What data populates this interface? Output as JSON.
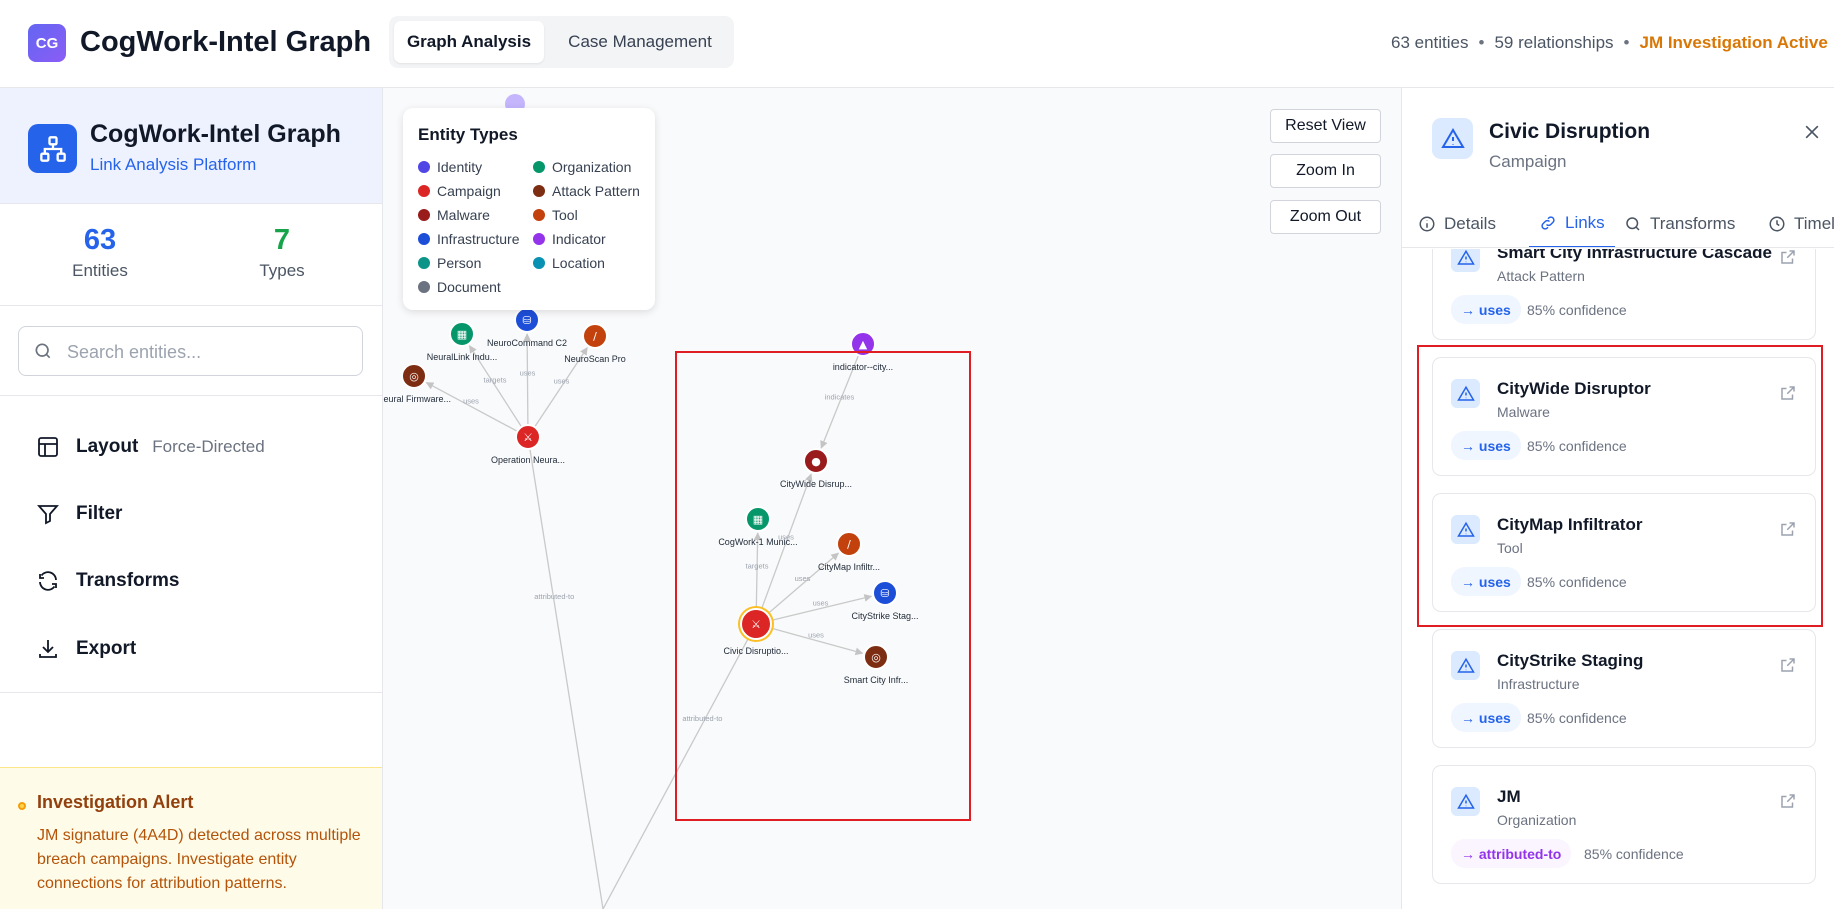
{
  "header": {
    "logo_text": "CG",
    "app_title": "CogWork-Intel Graph",
    "tabs": [
      {
        "label": "Graph Analysis",
        "active": true
      },
      {
        "label": "Case Management",
        "active": false
      }
    ],
    "stats": {
      "entities": "63 entities",
      "relationships": "59 relationships",
      "investigation": "JM Investigation Active"
    }
  },
  "sidebar": {
    "title": "CogWork-Intel Graph",
    "subtitle": "Link Analysis Platform",
    "stat_entities": {
      "value": "63",
      "label": "Entities"
    },
    "stat_types": {
      "value": "7",
      "label": "Types"
    },
    "search": {
      "placeholder": "Search entities..."
    },
    "menu": [
      {
        "label": "Layout",
        "value": "Force-Directed",
        "icon": "layout-icon"
      },
      {
        "label": "Filter",
        "icon": "filter-icon"
      },
      {
        "label": "Transforms",
        "icon": "transforms-icon"
      },
      {
        "label": "Export",
        "icon": "export-icon"
      }
    ],
    "alert": {
      "title": "Investigation Alert",
      "text": "JM signature (4A4D) detected across multiple breach campaigns. Investigate entity connections for attribution patterns."
    }
  },
  "canvas": {
    "legend": {
      "title": "Entity Types",
      "items": [
        {
          "label": "Identity",
          "color": "#4f46e5"
        },
        {
          "label": "Organization",
          "color": "#059669"
        },
        {
          "label": "Campaign",
          "color": "#dc2626"
        },
        {
          "label": "Attack Pattern",
          "color": "#7c2d12"
        },
        {
          "label": "Malware",
          "color": "#991b1b"
        },
        {
          "label": "Tool",
          "color": "#c2410c"
        },
        {
          "label": "Infrastructure",
          "color": "#1d4ed8"
        },
        {
          "label": "Indicator",
          "color": "#9333ea"
        },
        {
          "label": "Person",
          "color": "#0d9488"
        },
        {
          "label": "Location",
          "color": "#0891b2"
        },
        {
          "label": "Document",
          "color": "#6b7280"
        }
      ]
    },
    "controls": {
      "reset": "Reset View",
      "zoom_in": "Zoom In",
      "zoom_out": "Zoom Out"
    },
    "nodes": [
      {
        "id": "neurolink",
        "label": "NeuralLink Indu...",
        "type": "Organization",
        "color": "#059669",
        "glyph": "▦"
      },
      {
        "id": "neurocmd",
        "label": "NeuroCommand C2",
        "type": "Infrastructure",
        "color": "#1d4ed8",
        "glyph": "⛁"
      },
      {
        "id": "neuroscan",
        "label": "NeuroScan Pro",
        "type": "Tool",
        "color": "#c2410c",
        "glyph": "/"
      },
      {
        "id": "neuralfw",
        "label": "Neural Firmware...",
        "type": "Attack Pattern",
        "color": "#7c2d12",
        "glyph": "◎"
      },
      {
        "id": "opneura",
        "label": "Operation Neura...",
        "type": "Campaign",
        "color": "#dc2626",
        "glyph": "⚔"
      },
      {
        "id": "indicator",
        "label": "indicator--city...",
        "type": "Indicator",
        "color": "#9333ea",
        "glyph": "▲"
      },
      {
        "id": "citywide",
        "label": "CityWide Disrup...",
        "type": "Malware",
        "color": "#991b1b",
        "glyph": "●"
      },
      {
        "id": "cogwork",
        "label": "CogWork-1 Munic...",
        "type": "Organization",
        "color": "#059669",
        "glyph": "▦"
      },
      {
        "id": "citymap",
        "label": "CityMap Infiltr...",
        "type": "Tool",
        "color": "#c2410c",
        "glyph": "/"
      },
      {
        "id": "citystrike",
        "label": "CityStrike Stag...",
        "type": "Infrastructure",
        "color": "#1d4ed8",
        "glyph": "⛁"
      },
      {
        "id": "civic",
        "label": "Civic Disruptio...",
        "type": "Campaign",
        "color": "#dc2626",
        "glyph": "⚔",
        "selected": true
      },
      {
        "id": "smartcity",
        "label": "Smart City Infr...",
        "type": "Attack Pattern",
        "color": "#7c2d12",
        "glyph": "◎"
      }
    ],
    "edges": [
      {
        "label": "targets",
        "from": "opneura",
        "to": "neurolink"
      },
      {
        "label": "uses",
        "from": "opneura",
        "to": "neurocmd"
      },
      {
        "label": "uses",
        "from": "opneura",
        "to": "neuroscan"
      },
      {
        "label": "uses",
        "from": "opneura",
        "to": "neuralfw"
      },
      {
        "label": "attributed-to",
        "from": "opneura",
        "to": "jm-below"
      },
      {
        "label": "indicates",
        "from": "indicator",
        "to": "citywide"
      },
      {
        "label": "targets",
        "from": "civic",
        "to": "cogwork"
      },
      {
        "label": "uses",
        "from": "civic",
        "to": "citywide"
      },
      {
        "label": "uses",
        "from": "civic",
        "to": "citymap"
      },
      {
        "label": "uses",
        "from": "civic",
        "to": "citystrike"
      },
      {
        "label": "uses",
        "from": "civic",
        "to": "smartcity"
      },
      {
        "label": "attributed-to",
        "from": "civic",
        "to": "jm-below"
      }
    ]
  },
  "details": {
    "title": "Civic Disruption",
    "type": "Campaign",
    "tabs": [
      {
        "label": "Details",
        "icon": "info-icon"
      },
      {
        "label": "Links",
        "icon": "link-icon",
        "active": true
      },
      {
        "label": "Transforms",
        "icon": "search-icon"
      },
      {
        "label": "Timel",
        "icon": "clock-icon"
      }
    ],
    "links": [
      {
        "name": "Smart City Infrastructure Cascade",
        "type": "Attack Pattern",
        "rel": "→ uses",
        "confidence": "85% confidence"
      },
      {
        "name": "CityWide Disruptor",
        "type": "Malware",
        "rel": "→ uses",
        "confidence": "85% confidence"
      },
      {
        "name": "CityMap Infiltrator",
        "type": "Tool",
        "rel": "→ uses",
        "confidence": "85% confidence"
      },
      {
        "name": "CityStrike Staging",
        "type": "Infrastructure",
        "rel": "→ uses",
        "confidence": "85% confidence"
      },
      {
        "name": "JM",
        "type": "Organization",
        "rel": "→ attributed-to",
        "confidence": "85% confidence",
        "rel_color": "purple"
      }
    ]
  }
}
